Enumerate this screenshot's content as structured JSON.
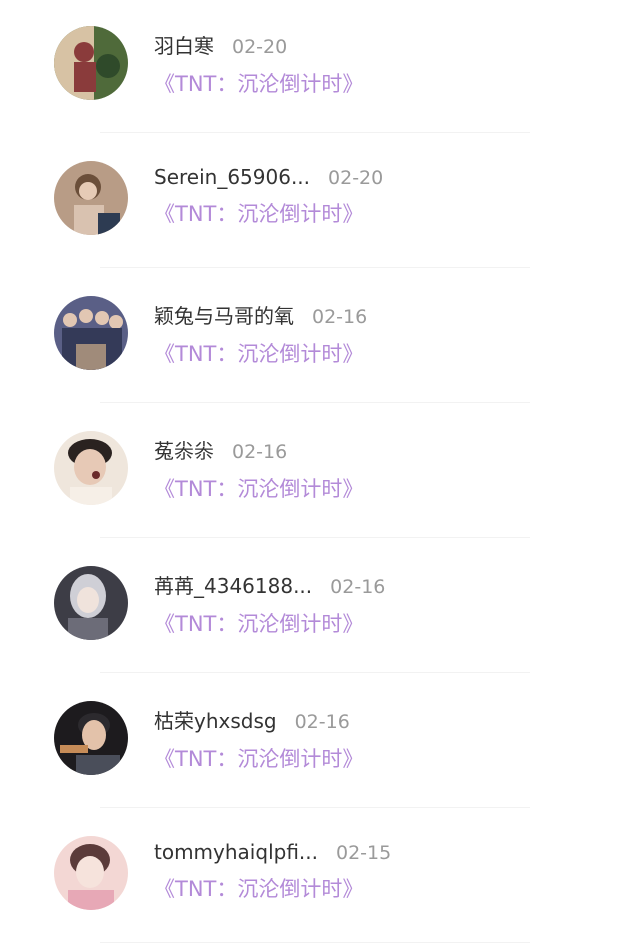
{
  "comments": [
    {
      "name": "羽白寒",
      "date": "02-20",
      "work": "《TNT：沉沦倒计时》",
      "avatar_icon": "avatar-illustration-icon",
      "colors": [
        "#8a3b3b",
        "#4f6a3a",
        "#d7c2a4"
      ]
    },
    {
      "name": "Serein_65906...",
      "date": "02-20",
      "work": "《TNT：沉沦倒计时》",
      "avatar_icon": "avatar-photo-icon",
      "colors": [
        "#6b4f3a",
        "#d9c2b0",
        "#2d3b52"
      ]
    },
    {
      "name": "颖兔与马哥的氧",
      "date": "02-16",
      "work": "《TNT：沉沦倒计时》",
      "avatar_icon": "avatar-group-photo-icon",
      "colors": [
        "#5a5f86",
        "#a08b7a",
        "#343a58"
      ]
    },
    {
      "name": "菟尜尜",
      "date": "02-16",
      "work": "《TNT：沉沦倒计时》",
      "avatar_icon": "avatar-portrait-icon",
      "colors": [
        "#2a2220",
        "#e7c9b6",
        "#efe6dc"
      ]
    },
    {
      "name": "苒苒_4346188...",
      "date": "02-16",
      "work": "《TNT：沉沦倒计时》",
      "avatar_icon": "avatar-illustration-icon",
      "colors": [
        "#3d3d46",
        "#cfcfd6",
        "#6c6c78"
      ]
    },
    {
      "name": "枯荣yhxsdsg",
      "date": "02-16",
      "work": "《TNT：沉沦倒计时》",
      "avatar_icon": "avatar-portrait-icon",
      "colors": [
        "#1d1b1e",
        "#c68c58",
        "#4a4e5a"
      ]
    },
    {
      "name": "tommyhaiqlpfi...",
      "date": "02-15",
      "work": "《TNT：沉沦倒计时》",
      "avatar_icon": "avatar-photo-icon",
      "colors": [
        "#e7a8b6",
        "#f3d7d4",
        "#5b3b3a"
      ]
    }
  ]
}
